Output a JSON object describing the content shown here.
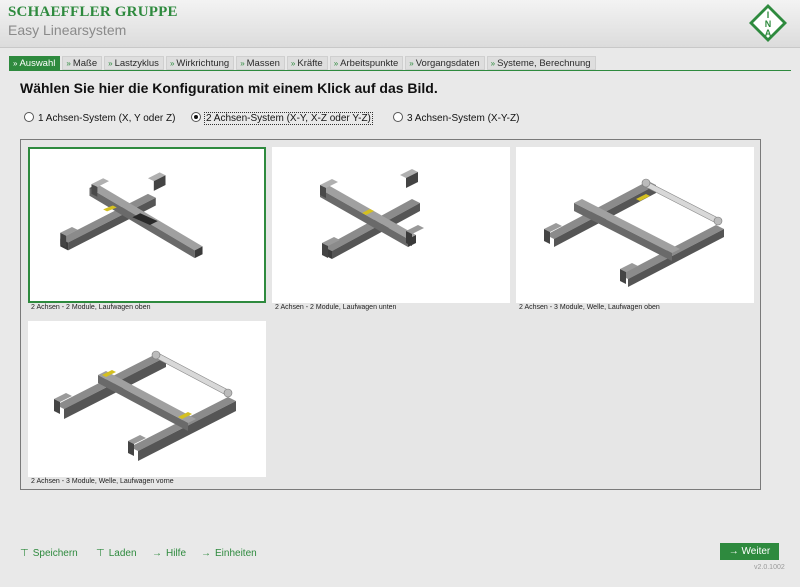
{
  "header": {
    "brand": "SCHAEFFLER GRUPPE",
    "app_title": "Easy Linearsystem",
    "logo_text": "INA"
  },
  "tabs": [
    {
      "label": "Auswahl",
      "active": true
    },
    {
      "label": "Maße",
      "active": false
    },
    {
      "label": "Lastzyklus",
      "active": false
    },
    {
      "label": "Wirkrichtung",
      "active": false
    },
    {
      "label": "Massen",
      "active": false
    },
    {
      "label": "Kräfte",
      "active": false
    },
    {
      "label": "Arbeitspunkte",
      "active": false
    },
    {
      "label": "Vorgangsdaten",
      "active": false
    },
    {
      "label": "Systeme, Berechnung",
      "active": false
    }
  ],
  "instruction": "Wählen Sie hier die Konfiguration mit einem Klick auf das Bild.",
  "axis_options": [
    {
      "label": "1 Achsen-System (X, Y oder Z)",
      "selected": false
    },
    {
      "label": "2 Achsen-System (X-Y, X-Z oder Y-Z)",
      "selected": true
    },
    {
      "label": "3 Achsen-System (X-Y-Z)",
      "selected": false
    }
  ],
  "configurations": [
    {
      "caption": "2 Achsen - 2 Module, Laufwagen oben",
      "selected": true
    },
    {
      "caption": "2 Achsen - 2 Module, Laufwagen unten",
      "selected": false
    },
    {
      "caption": "2 Achsen - 3 Module, Welle, Laufwagen oben",
      "selected": false
    },
    {
      "caption": "2 Achsen - 3 Module, Welle, Laufwagen vorne",
      "selected": false
    }
  ],
  "footer": {
    "save": "Speichern",
    "load": "Laden",
    "help": "Hilfe",
    "settings": "Einheiten",
    "next": "Weiter",
    "version": "v2.0.1002"
  },
  "colors": {
    "accent": "#2e8a3e",
    "background": "#e9e9e9"
  },
  "icons": {
    "tab_marker": "double-chevron-right-icon",
    "save": "save-icon",
    "load": "load-icon",
    "help": "help-icon",
    "settings": "units-icon",
    "next": "arrow-right-icon"
  }
}
